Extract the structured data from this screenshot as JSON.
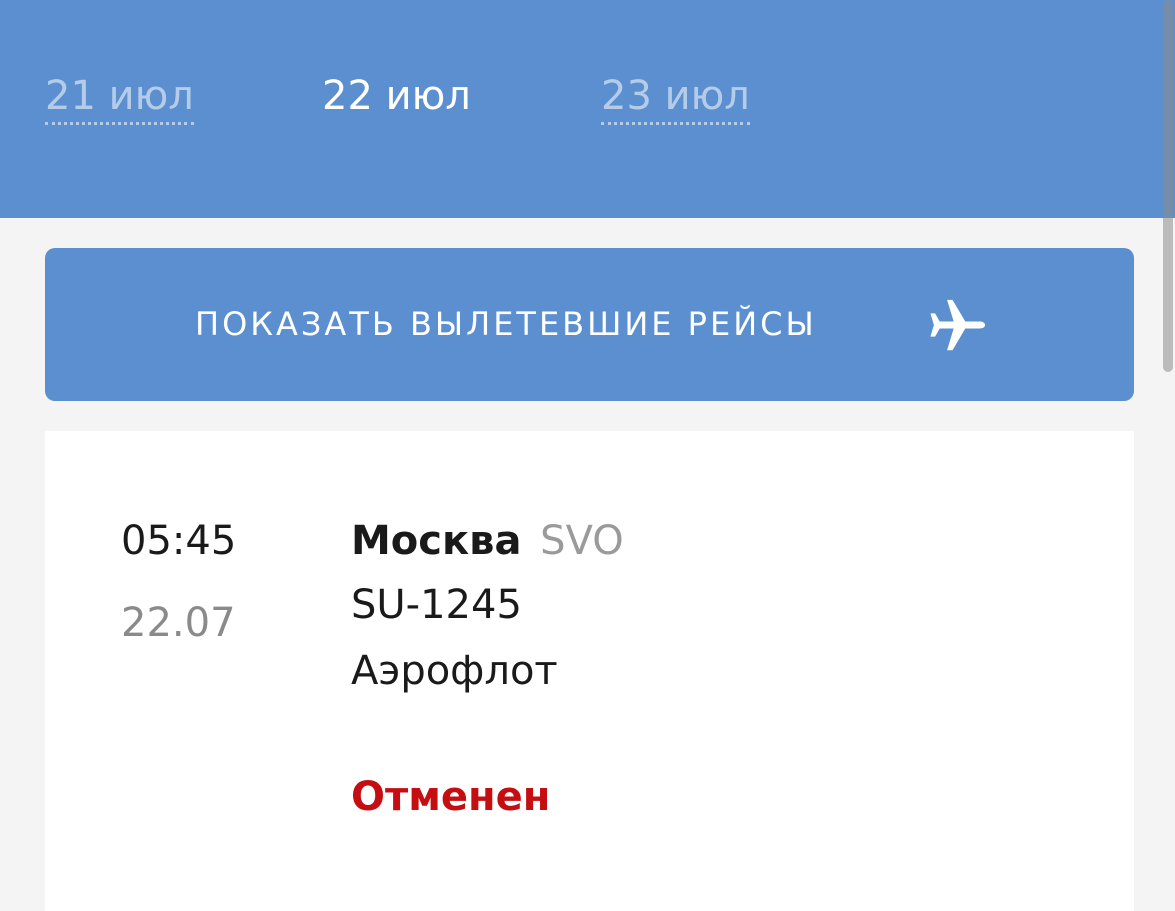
{
  "date_tabs": [
    {
      "label": "21 июл",
      "state": "inactive"
    },
    {
      "label": "22 июл",
      "state": "active"
    },
    {
      "label": "23 июл",
      "state": "inactive"
    }
  ],
  "show_departed_button": {
    "label": "ПОКАЗАТЬ ВЫЛЕТЕВШИЕ РЕЙСЫ",
    "icon": "airplane-icon"
  },
  "flight": {
    "time": "05:45",
    "date": "22.07",
    "city": "Москва",
    "airport_code": "SVO",
    "flight_number": "SU-1245",
    "airline": "Аэрофлот",
    "status": "Отменен"
  },
  "colors": {
    "brand_blue": "#5b8fcf",
    "status_cancelled": "#c40e12",
    "background": "#f4f4f4"
  }
}
